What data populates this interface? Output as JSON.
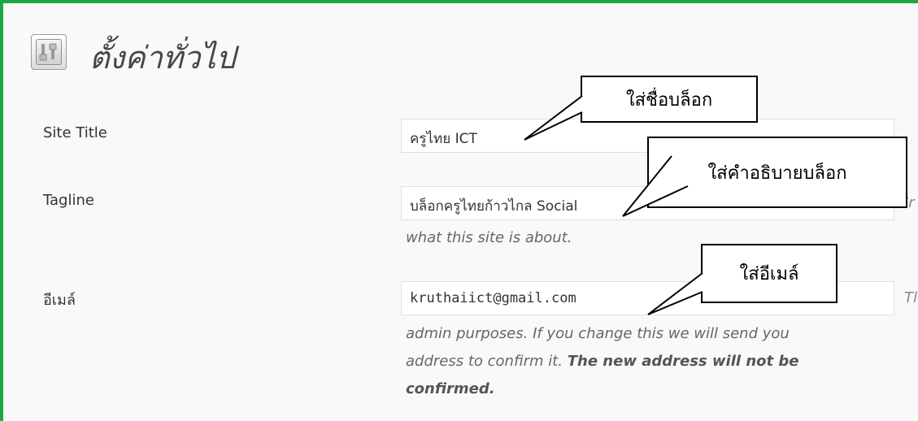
{
  "page": {
    "title": "ตั้งค่าทั่วไป",
    "icon": "settings-tools-icon",
    "accent_border": "#1aa845"
  },
  "fields": {
    "site_title": {
      "label": "Site Title",
      "value": "ครูไทย ICT"
    },
    "tagline": {
      "label": "Tagline",
      "value": "บล็อกครูไทยก้าวไกล Social",
      "description": "what this site is about.",
      "side_text": "Ir"
    },
    "email": {
      "label": "อีเมล์",
      "value": "kruthaiict@gmail.com",
      "side_text": "Tl",
      "description_line1": "admin purposes. If you change this we will send you",
      "description_line2_plain": "address to confirm it. ",
      "description_line2_bold": "The new address will not be",
      "description_line3_bold": "confirmed."
    }
  },
  "callouts": {
    "site_name": "ใส่ชื่อบล็อก",
    "description": "ใส่คำอธิบายบล็อก",
    "email": "ใส่อีเมล์"
  }
}
